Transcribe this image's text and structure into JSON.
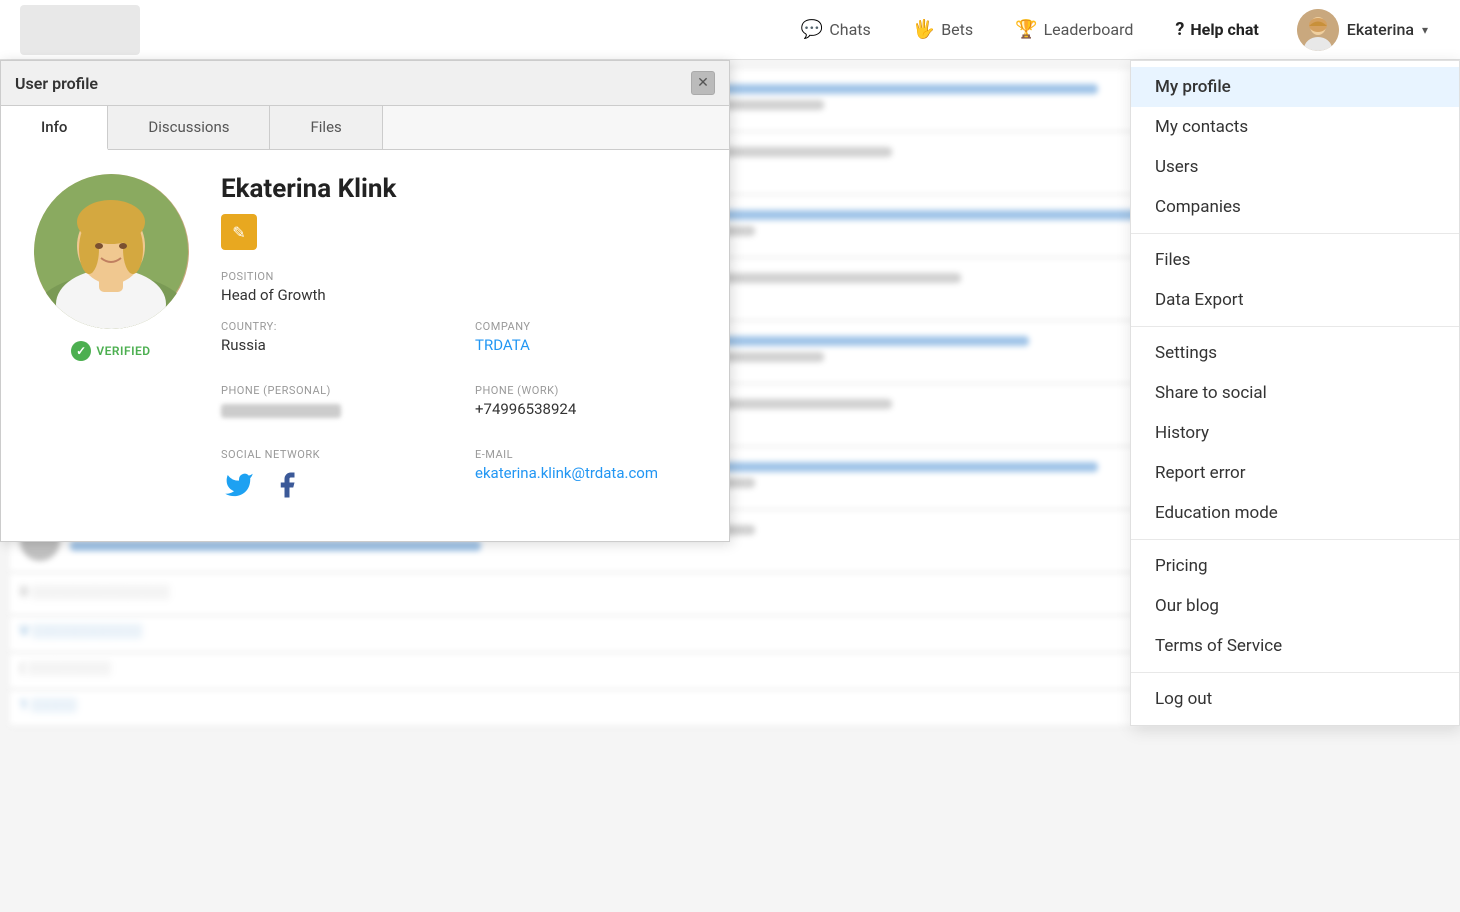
{
  "navbar": {
    "logo_alt": "Logo",
    "nav_items": [
      {
        "id": "chats",
        "label": "Chats",
        "icon": "💬"
      },
      {
        "id": "bets",
        "label": "Bets",
        "icon": "🖐"
      },
      {
        "id": "leaderboard",
        "label": "Leaderboard",
        "icon": "🏆"
      },
      {
        "id": "help-chat",
        "label": "Help chat",
        "icon": "?",
        "bold": true
      }
    ],
    "user": {
      "name": "Ekaterina",
      "avatar_alt": "Ekaterina avatar"
    }
  },
  "modal": {
    "title": "User profile",
    "close_label": "✕",
    "tabs": [
      {
        "id": "info",
        "label": "Info",
        "active": true
      },
      {
        "id": "discussions",
        "label": "Discussions",
        "active": false
      },
      {
        "id": "files",
        "label": "Files",
        "active": false
      }
    ],
    "profile": {
      "name": "Ekaterina Klink",
      "verified_label": "VERIFIED",
      "edit_icon": "✎",
      "position_label": "POSITION",
      "position_value": "Head of Growth",
      "country_label": "COUNTRY:",
      "country_value": "Russia",
      "company_label": "COMPANY",
      "company_value": "TRDATA",
      "phone_personal_label": "PHONE (PERSONAL)",
      "phone_work_label": "PHONE (WORK)",
      "phone_work_value": "+74996538924",
      "social_label": "SOCIAL NETWORK",
      "email_label": "E-MAIL",
      "email_value": "ekaterina.klink@trdata.com"
    }
  },
  "dropdown": {
    "sections": [
      {
        "items": [
          {
            "id": "my-profile",
            "label": "My profile",
            "active": true
          },
          {
            "id": "my-contacts",
            "label": "My contacts",
            "active": false
          },
          {
            "id": "users",
            "label": "Users",
            "active": false
          },
          {
            "id": "companies",
            "label": "Companies",
            "active": false
          }
        ]
      },
      {
        "items": [
          {
            "id": "files",
            "label": "Files",
            "active": false
          },
          {
            "id": "data-export",
            "label": "Data Export",
            "active": false
          }
        ]
      },
      {
        "items": [
          {
            "id": "settings",
            "label": "Settings",
            "active": false
          },
          {
            "id": "share-social",
            "label": "Share to social",
            "active": false
          },
          {
            "id": "history",
            "label": "History",
            "active": false
          },
          {
            "id": "report-error",
            "label": "Report error",
            "active": false
          },
          {
            "id": "education-mode",
            "label": "Education mode",
            "active": false
          }
        ]
      },
      {
        "items": [
          {
            "id": "pricing",
            "label": "Pricing",
            "active": false
          },
          {
            "id": "our-blog",
            "label": "Our blog",
            "active": false
          },
          {
            "id": "terms",
            "label": "Terms of Service",
            "active": false
          }
        ]
      },
      {
        "items": [
          {
            "id": "log-out",
            "label": "Log out",
            "active": false
          }
        ]
      }
    ]
  },
  "background_chats": [
    {
      "avatar_color": "#a0c4e8",
      "line1_width": "75%",
      "line2_width": "55%"
    },
    {
      "avatar_color": "#b0b8c8",
      "line1_width": "60%",
      "line2_width": "40%"
    },
    {
      "avatar_color": "#c8a070",
      "line1_width": "80%",
      "line2_width": "50%"
    },
    {
      "avatar_color": "#7090b8",
      "line1_width": "65%",
      "line2_width": "45%"
    },
    {
      "avatar_color": "#e0a0a8",
      "line1_width": "70%",
      "line2_width": "55%"
    },
    {
      "avatar_color": "#8090c0",
      "line1_width": "60%",
      "line2_width": "35%"
    },
    {
      "avatar_color": "#c0b890",
      "line1_width": "75%",
      "line2_width": "50%"
    }
  ]
}
